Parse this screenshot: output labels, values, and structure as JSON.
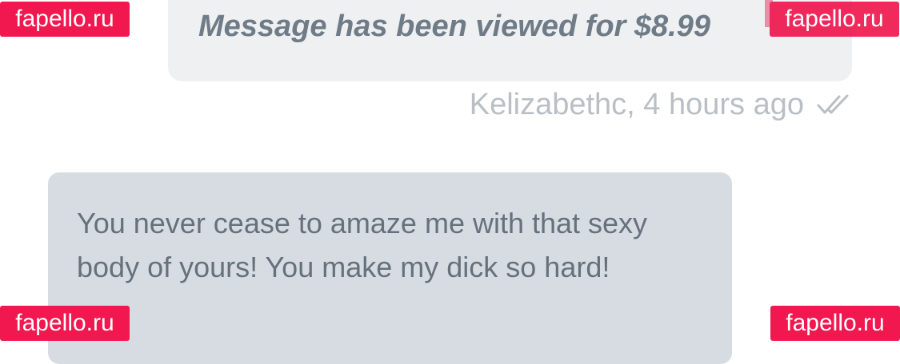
{
  "outgoing_message": {
    "text": "Message has been viewed for $8.99"
  },
  "outgoing_meta": {
    "text": "Kelizabethc, 4 hours ago",
    "status_icon": "double-check-icon"
  },
  "incoming_message": {
    "text": "You never cease to amaze me with that sexy body of yours! You make my dick so hard!"
  },
  "watermarks": {
    "top_left": "fapello.ru",
    "top_right": "fapello.ru",
    "bottom_left": "fapello.ru",
    "bottom_right": "fapello.ru"
  },
  "colors": {
    "watermark_bg": "#f0184f",
    "outgoing_bubble_bg": "#eef0f2",
    "incoming_bubble_bg": "#d6dce2",
    "meta_text": "#b9bfc5"
  }
}
